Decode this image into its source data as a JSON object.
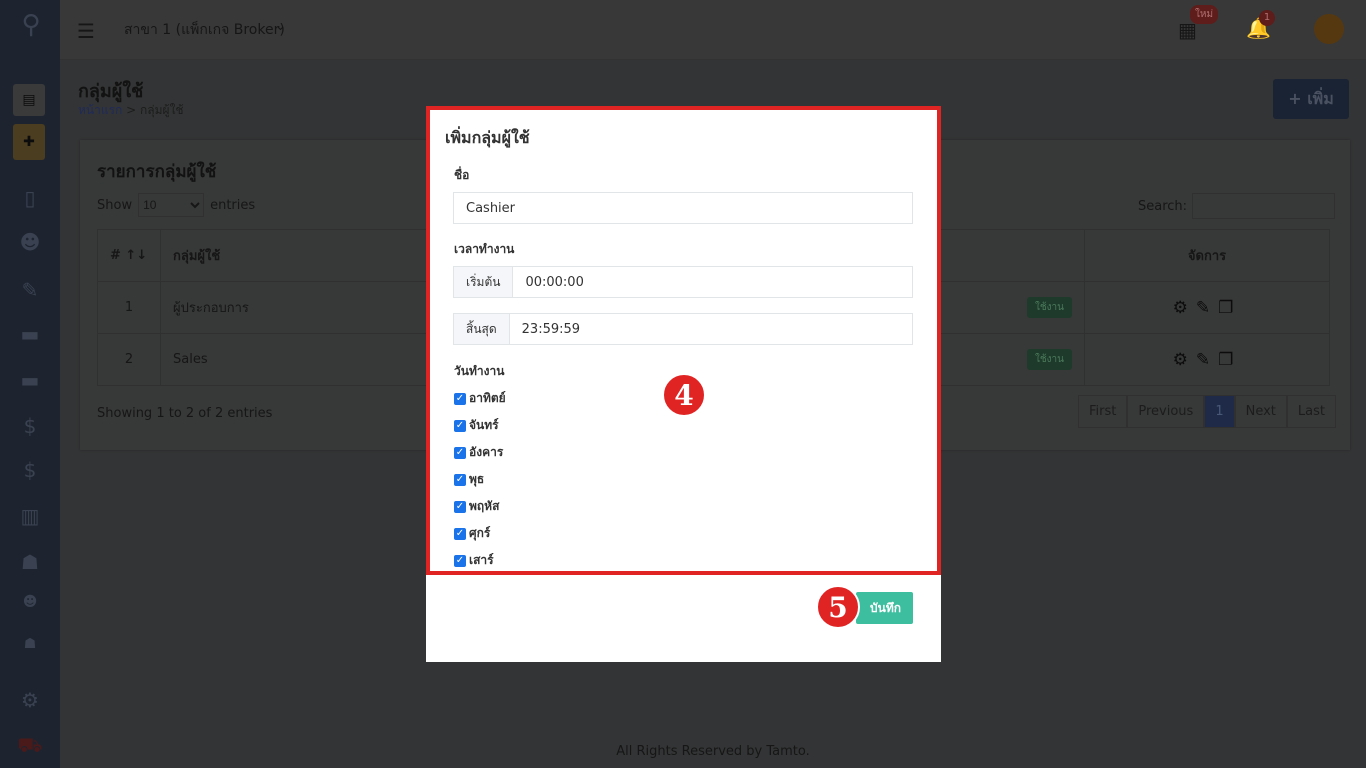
{
  "navbar": {
    "branch": "สาขา 1 (แพ็กเกจ Broker)",
    "new_badge": "ใหม่",
    "notif_count": "1"
  },
  "page": {
    "title": "กลุ่มผู้ใช้",
    "breadcrumb_home": "หน้าแรก",
    "breadcrumb_sep": ">",
    "breadcrumb_current": "กลุ่มผู้ใช้",
    "add_label": "+ เพิ่ม"
  },
  "card": {
    "title": "รายการกลุ่มผู้ใช้",
    "show": "Show",
    "entries_value": "10",
    "entries": "entries",
    "search": "Search:",
    "columns": [
      "#",
      "กลุ่มผู้ใช้",
      "",
      "จัดการ"
    ],
    "rows": [
      {
        "no": "1",
        "name": "ผู้ประกอบการ",
        "status": "ใช้งาน"
      },
      {
        "no": "2",
        "name": "Sales",
        "status": "ใช้งาน"
      }
    ],
    "showing": "Showing 1 to 2 of 2 entries",
    "pager": [
      "First",
      "Previous",
      "1",
      "Next",
      "Last"
    ]
  },
  "footer": "All Rights Reserved by Tamto.",
  "modal": {
    "title": "เพิ่มกลุ่มผู้ใช้",
    "name_label": "ชื่อ",
    "name_value": "Cashier",
    "time_label": "เวลาทำงาน",
    "start_label": "เริ่มต้น",
    "start_value": "00:00:00",
    "end_label": "สิ้นสุด",
    "end_value": "23:59:59",
    "days_label": "วันทำงาน",
    "days": [
      {
        "label": "อาทิตย์",
        "checked": true
      },
      {
        "label": "จันทร์",
        "checked": true
      },
      {
        "label": "อังคาร",
        "checked": true
      },
      {
        "label": "พุธ",
        "checked": true
      },
      {
        "label": "พฤหัส",
        "checked": true
      },
      {
        "label": "ศุกร์",
        "checked": true
      },
      {
        "label": "เสาร์",
        "checked": true
      }
    ],
    "save": "บันทึก"
  },
  "annotations": {
    "step4": "4",
    "step5": "5",
    "color": "#e02424"
  }
}
